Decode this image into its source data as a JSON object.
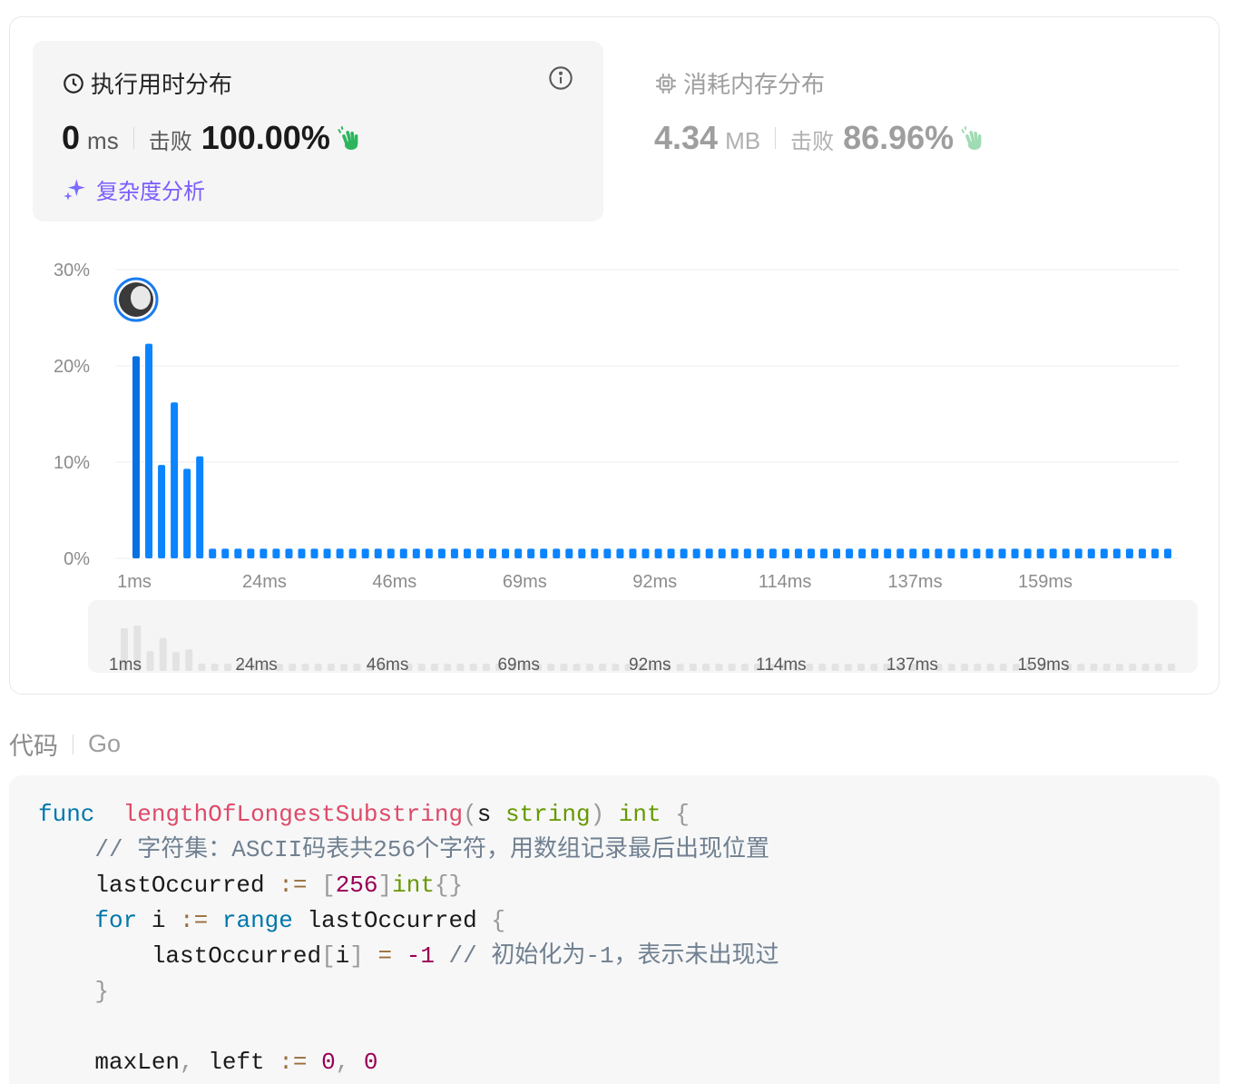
{
  "runtime": {
    "title": "执行用时分布",
    "value": "0",
    "unit": "ms",
    "beat_label": "击败",
    "beat_pct": "100.00%",
    "complexity_label": "复杂度分析"
  },
  "memory": {
    "title": "消耗内存分布",
    "value": "4.34",
    "unit": "MB",
    "beat_label": "击败",
    "beat_pct": "86.96%"
  },
  "chart_data": {
    "type": "bar",
    "ylabel": "",
    "ylim": [
      0,
      30
    ],
    "y_ticks": [
      "30%",
      "20%",
      "10%",
      "0%"
    ],
    "x_ticks": [
      "1ms",
      "24ms",
      "46ms",
      "69ms",
      "92ms",
      "114ms",
      "137ms",
      "159ms"
    ],
    "series": [
      {
        "values": [
          21.0,
          22.3,
          9.7,
          16.2,
          9.3,
          10.6,
          1,
          1,
          1,
          1,
          1,
          1,
          1,
          1,
          1,
          1,
          1,
          1,
          1,
          1,
          1,
          1,
          1,
          1,
          1,
          1,
          1,
          1,
          1,
          1,
          1,
          1,
          1,
          1,
          1,
          1,
          1,
          1,
          1,
          1,
          1,
          1,
          1,
          1,
          1,
          1,
          1,
          1,
          1,
          1,
          1,
          1,
          1,
          1,
          1,
          1,
          1,
          1,
          1,
          1,
          1,
          1,
          1,
          1,
          1,
          1,
          1,
          1,
          1,
          1,
          1,
          1,
          1,
          1,
          1,
          1,
          1,
          1,
          1,
          1,
          1,
          1
        ]
      }
    ],
    "highlight_index": 0,
    "bar_color": "#0a84ff",
    "mini_bar_color": "#e3e3e3"
  },
  "code": {
    "label": "代码",
    "language": "Go",
    "lines": [
      [
        [
          "kw",
          "func"
        ],
        [
          "",
          "  "
        ],
        [
          "fn",
          "lengthOfLongestSubstring"
        ],
        [
          "pn",
          "("
        ],
        [
          "",
          "s "
        ],
        [
          "ty",
          "string"
        ],
        [
          "pn",
          ")"
        ],
        [
          "",
          ""
        ],
        [
          "ty",
          " int"
        ],
        [
          "",
          ""
        ],
        [
          "pn",
          " {"
        ]
      ],
      [
        [
          "",
          "    "
        ],
        [
          "cm",
          "// 字符集：ASCII码表共256个字符，用数组记录最后出现位置"
        ]
      ],
      [
        [
          "",
          "    lastOccurred "
        ],
        [
          "op",
          ":="
        ],
        [
          "",
          ""
        ],
        [
          "pn",
          " ["
        ],
        [
          "num",
          "256"
        ],
        [
          "pn",
          "]"
        ],
        [
          "ty",
          "int"
        ],
        [
          "pn",
          "{}"
        ]
      ],
      [
        [
          "",
          "    "
        ],
        [
          "kw",
          "for"
        ],
        [
          "",
          " i "
        ],
        [
          "op",
          ":="
        ],
        [
          "",
          " "
        ],
        [
          "kw",
          "range"
        ],
        [
          "",
          " lastOccurred "
        ],
        [
          "pn",
          "{"
        ]
      ],
      [
        [
          "",
          "        lastOccurred"
        ],
        [
          "pn",
          "["
        ],
        [
          "",
          "i"
        ],
        [
          "pn",
          "]"
        ],
        [
          "",
          " "
        ],
        [
          "op",
          "="
        ],
        [
          "",
          " "
        ],
        [
          "num",
          "-1"
        ],
        [
          "",
          " "
        ],
        [
          "cm",
          "// 初始化为-1，表示未出现过"
        ]
      ],
      [
        [
          "",
          "    "
        ],
        [
          "pn",
          "}"
        ]
      ],
      [
        [
          "",
          ""
        ]
      ],
      [
        [
          "",
          "    maxLen"
        ],
        [
          "pn",
          ","
        ],
        [
          "",
          " left "
        ],
        [
          "op",
          ":="
        ],
        [
          "",
          " "
        ],
        [
          "num",
          "0"
        ],
        [
          "pn",
          ","
        ],
        [
          "",
          " "
        ],
        [
          "num",
          "0"
        ]
      ]
    ]
  }
}
